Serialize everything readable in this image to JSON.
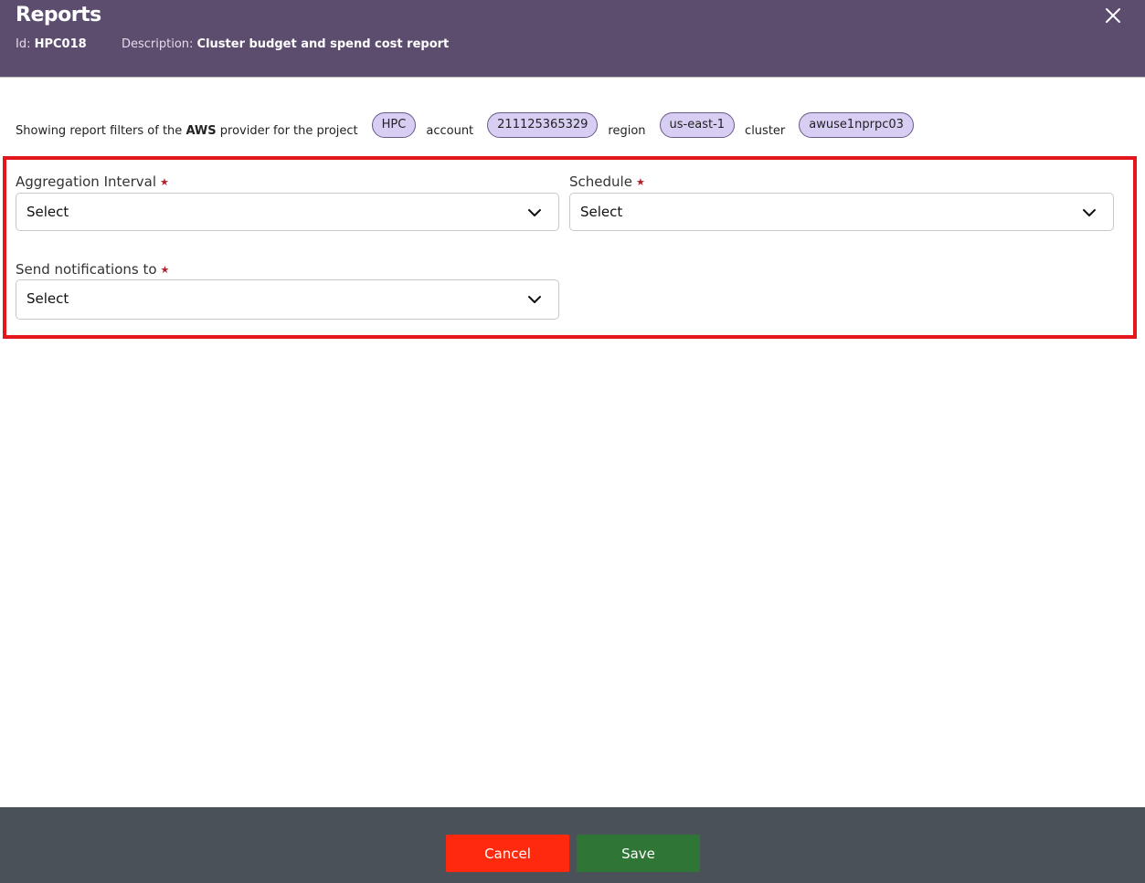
{
  "header": {
    "title": "Reports",
    "id_label": "Id:",
    "id_value": "HPC018",
    "description_label": "Description:",
    "description_value": "Cluster budget and spend cost report"
  },
  "filters": {
    "prefix": "Showing report filters of the ",
    "provider": "AWS",
    "provider_suffix": " provider for the project",
    "project": "HPC",
    "account_label": "account",
    "account": "211125365329",
    "region_label": "region",
    "region": "us-east-1",
    "cluster_label": "cluster",
    "cluster": "awuse1nprpc03"
  },
  "form": {
    "aggregation_interval": {
      "label": "Aggregation Interval",
      "value": "Select"
    },
    "schedule": {
      "label": "Schedule",
      "value": "Select"
    },
    "notifications": {
      "label": "Send notifications to",
      "value": "Select"
    },
    "required_marker": "★"
  },
  "footer": {
    "cancel_label": "Cancel",
    "save_label": "Save"
  },
  "colors": {
    "header_bg": "#5c4d6f",
    "chip_bg": "#d8cdf2",
    "highlight_border": "#e3161b",
    "cancel_bg": "#ff2a0e",
    "save_bg": "#2f7535",
    "footer_bg": "#4b5158"
  }
}
